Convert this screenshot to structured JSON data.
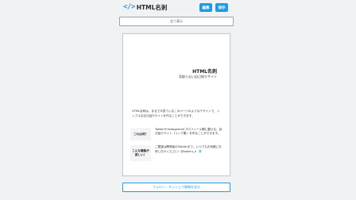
{
  "header": {
    "logo_icon": "</>",
    "logo_text": "HTML名刺",
    "edit_label": "編集",
    "save_label": "保存"
  },
  "show_all_label": "全て表示",
  "card": {
    "title": "HTML名刺",
    "subtitle": "気取らない自己紹介サイト",
    "intro": "HTML名刺は、まるで今見ているこのページのようなデザインで、シンプルな自己紹介サイトを作ることができます。",
    "rows": [
      {
        "label": "これは何？",
        "value": "TwitterやInstagramのプロフィール欄に載せる、自己紹介サイト（リンク集）を作ることができます。"
      },
      {
        "label": "こんな機能が欲しい！",
        "value": "ご要望は開発者のTwitterまで。いつでもお気軽にお申し付けください！@kakeru_h",
        "link_icon": "external-link-icon"
      }
    ]
  },
  "follow_label": "フォロー・ネット上で情報を見る",
  "colors": {
    "accent": "#1e9be6",
    "background": "#f1f2f4"
  }
}
